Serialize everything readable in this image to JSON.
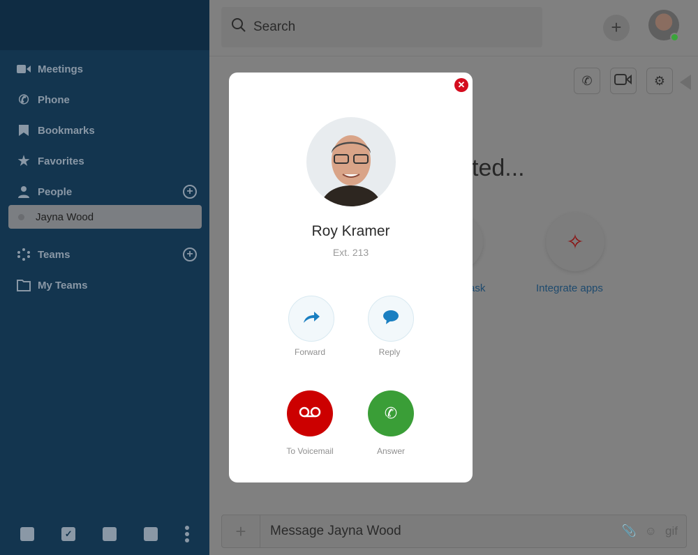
{
  "sidebar": {
    "items": [
      {
        "label": "Meetings",
        "icon": "video-icon"
      },
      {
        "label": "Phone",
        "icon": "phone-icon"
      },
      {
        "label": "Bookmarks",
        "icon": "bookmark-icon"
      },
      {
        "label": "Favorites",
        "icon": "star-icon"
      },
      {
        "label": "People",
        "icon": "person-icon"
      },
      {
        "label": "Teams",
        "icon": "teams-icon"
      },
      {
        "label": "My Teams",
        "icon": "folder-icon"
      }
    ],
    "selected_contact": "Jayna Wood",
    "bottom_icons": [
      "inbox-icon",
      "tasks-icon",
      "calendar-icon",
      "files-icon",
      "more-icon"
    ]
  },
  "header": {
    "search_placeholder": "Search",
    "add": "+"
  },
  "background": {
    "title_fragment": "ted...",
    "task_fragment": "ask",
    "integrate_label": "Integrate apps"
  },
  "composer": {
    "plus": "+",
    "placeholder": "Message Jayna Wood",
    "gif": "gif"
  },
  "call": {
    "caller_name": "Roy Kramer",
    "extension": "Ext. 213",
    "forward": "Forward",
    "reply": "Reply",
    "voicemail": "To Voicemail",
    "answer": "Answer",
    "colors": {
      "decline": "#cc0000",
      "answer": "#3a9e37",
      "accent": "#1a7fc1"
    }
  }
}
